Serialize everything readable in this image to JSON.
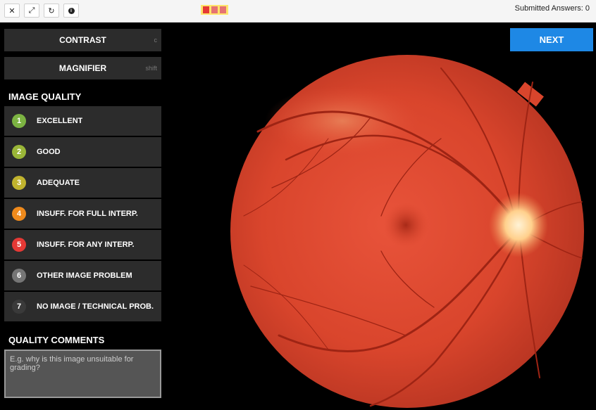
{
  "toolbar": {
    "icons": [
      "close-icon",
      "expand-icon",
      "refresh-icon",
      "info-icon"
    ],
    "progress_colors": [
      "#e53935",
      "#e57373",
      "#e57373"
    ],
    "submitted_label": "Submitted Answers: 0"
  },
  "tools": {
    "contrast": {
      "label": "CONTRAST",
      "shortcut": "c"
    },
    "magnifier": {
      "label": "MAGNIFIER",
      "shortcut": "shift"
    }
  },
  "image_quality": {
    "title": "IMAGE QUALITY",
    "options": [
      {
        "number": "1",
        "label": "EXCELLENT",
        "color": "#7cb342"
      },
      {
        "number": "2",
        "label": "GOOD",
        "color": "#9ab638"
      },
      {
        "number": "3",
        "label": "ADEQUATE",
        "color": "#c0b32e"
      },
      {
        "number": "4",
        "label": "INSUFF. FOR FULL INTERP.",
        "color": "#ef8a1c"
      },
      {
        "number": "5",
        "label": "INSUFF. FOR ANY INTERP.",
        "color": "#e53935"
      },
      {
        "number": "6",
        "label": "OTHER IMAGE PROBLEM",
        "color": "#757575"
      },
      {
        "number": "7",
        "label": "NO IMAGE / TECHNICAL PROB.",
        "color": "#3a3a3a"
      }
    ]
  },
  "comments": {
    "title": "QUALITY COMMENTS",
    "placeholder": "E.g. why is this image unsuitable for grading?"
  },
  "next_label": "NEXT"
}
